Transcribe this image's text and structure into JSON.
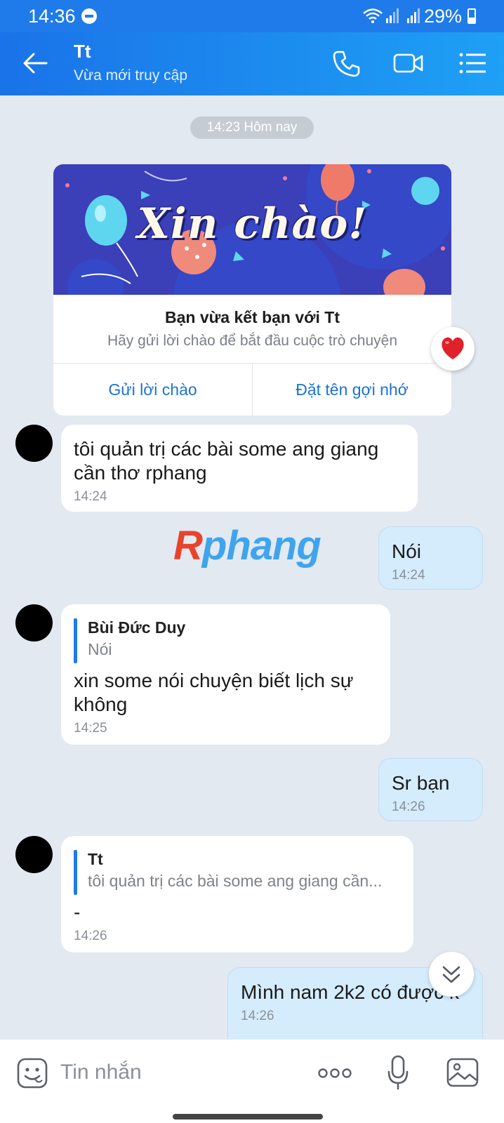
{
  "status_bar": {
    "time": "14:36",
    "battery": "29%"
  },
  "header": {
    "name": "Tt",
    "status": "Vừa mới truy cập"
  },
  "chat": {
    "date_pill": "14:23 Hôm nay",
    "friend_card": {
      "banner_text": "Xin chào!",
      "title": "Bạn vừa kết bạn với Tt",
      "subtitle": "Hãy gửi lời chào để bắt đầu cuộc trò chuyện",
      "button_greet": "Gửi lời chào",
      "button_nickname": "Đặt tên gợi nhớ"
    },
    "messages": [
      {
        "direction": "in",
        "text": "tôi quản trị các bài some ang giang cần thơ rphang",
        "time": "14:24"
      },
      {
        "direction": "out",
        "text": "Nói",
        "time": "14:24"
      },
      {
        "direction": "in",
        "quote_name": "Bùi Đức Duy",
        "quote_text": "Nói",
        "text": "xin some nói chuyện biết lịch sự không",
        "time": "14:25"
      },
      {
        "direction": "out",
        "text": "Sr bạn",
        "time": "14:26"
      },
      {
        "direction": "in",
        "quote_name": "Tt",
        "quote_text": "tôi quản trị các bài some ang giang cần...",
        "text": "-",
        "time": "14:26"
      },
      {
        "direction": "out",
        "text": "Mình nam 2k2 có được k",
        "time": "14:26"
      }
    ],
    "watermark": {
      "part1": "R",
      "part2": "phang"
    }
  },
  "input_bar": {
    "placeholder": "Tin nhắn"
  },
  "icons": [
    "back-arrow-icon",
    "phone-icon",
    "video-camera-icon",
    "menu-list-icon",
    "heart-icon",
    "chevron-double-down-icon",
    "sticker-icon",
    "more-dots-icon",
    "microphone-icon",
    "image-icon"
  ],
  "colors": {
    "header_start": "#1a73e8",
    "header_end": "#1ea0f5",
    "chat_bg": "#e2e9f1",
    "outgoing_bubble": "#d5ecfd",
    "link": "#1b73d3",
    "heart": "#e0202a"
  }
}
